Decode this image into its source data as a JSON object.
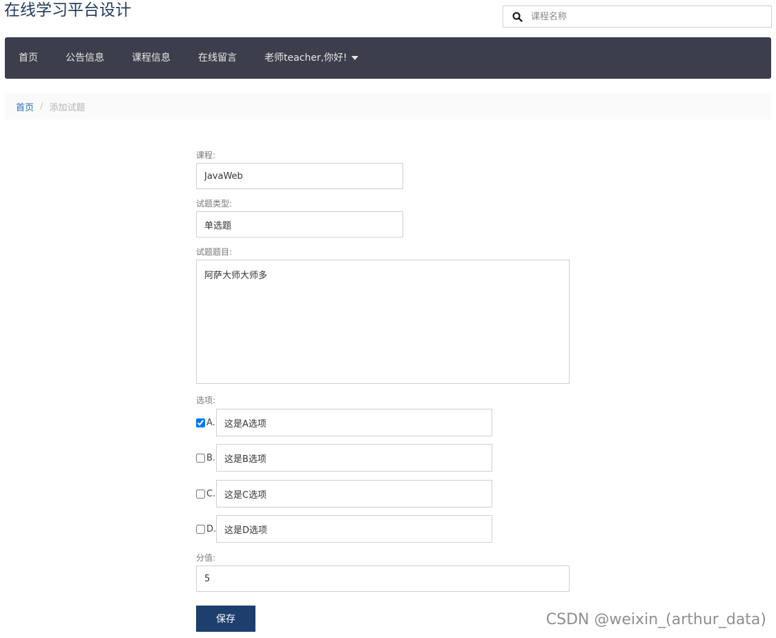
{
  "site": {
    "title": "在线学习平台设计"
  },
  "search": {
    "placeholder": "课程名称"
  },
  "nav": {
    "items": [
      {
        "label": "首页"
      },
      {
        "label": "公告信息"
      },
      {
        "label": "课程信息"
      },
      {
        "label": "在线留言"
      }
    ],
    "user_menu": {
      "label": "老师teacher,你好!"
    }
  },
  "breadcrumb": {
    "home": "首页",
    "separator": "/",
    "current": "添加试题"
  },
  "form": {
    "course": {
      "label": "课程:",
      "value": "JavaWeb"
    },
    "type": {
      "label": "试题类型:",
      "value": "单选题"
    },
    "question": {
      "label": "试题题目:",
      "value": "阿萨大师大师多"
    },
    "options": {
      "label": "选项:",
      "items": [
        {
          "letter": "A.",
          "value": "这是A选项",
          "checked": true
        },
        {
          "letter": "B.",
          "value": "这是B选项",
          "checked": false
        },
        {
          "letter": "C.",
          "value": "这是C选项",
          "checked": false
        },
        {
          "letter": "D.",
          "value": "这是D选项",
          "checked": false
        }
      ]
    },
    "score": {
      "label": "分值:",
      "value": "5"
    },
    "save_label": "保存"
  },
  "watermark": "CSDN @weixin_(arthur_data)",
  "colors": {
    "navbar": "#3c3f4b",
    "button": "#1c3f6e",
    "link": "#2470b8"
  }
}
